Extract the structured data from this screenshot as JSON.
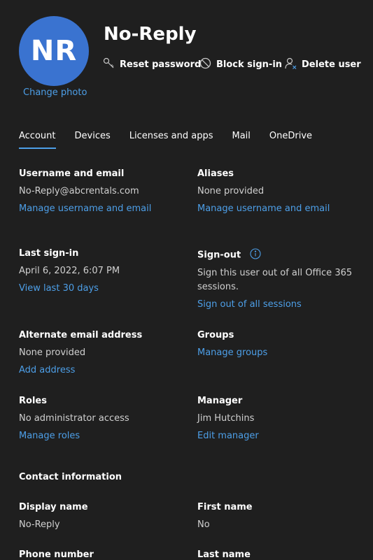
{
  "user": {
    "initials": "NR",
    "change_photo": "Change photo",
    "display_name": "No-Reply"
  },
  "actions": {
    "reset_password": "Reset password",
    "block_sign_in": "Block sign-in",
    "delete_user": "Delete user"
  },
  "tabs": [
    "Account",
    "Devices",
    "Licenses and apps",
    "Mail",
    "OneDrive"
  ],
  "account": {
    "username": {
      "label": "Username and email",
      "value": "No-Reply@abcrentals.com",
      "link": "Manage username and email"
    },
    "aliases": {
      "label": "Aliases",
      "value": "None provided",
      "link": "Manage username and email"
    },
    "last_signin": {
      "label": "Last sign-in",
      "value": "April 6, 2022, 6:07 PM",
      "link": "View last 30 days"
    },
    "signout": {
      "label": "Sign-out",
      "value_line1": "Sign this user out of all Office 365",
      "value_line2": "sessions.",
      "link": "Sign out of all sessions"
    },
    "alt_email": {
      "label": "Alternate email address",
      "value": "None provided",
      "link": "Add address"
    },
    "groups": {
      "label": "Groups",
      "link": "Manage groups"
    },
    "roles": {
      "label": "Roles",
      "value": "No administrator access",
      "link": "Manage roles"
    },
    "manager": {
      "label": "Manager",
      "value": "Jim Hutchins",
      "link": "Edit manager"
    }
  },
  "contact": {
    "heading": "Contact information",
    "display_name": {
      "label": "Display name",
      "value": "No-Reply"
    },
    "first_name": {
      "label": "First name",
      "value": "No"
    },
    "phone_number": {
      "label": "Phone number"
    },
    "last_name": {
      "label": "Last name"
    }
  },
  "colors": {
    "background": "#1f1f1f",
    "accent": "#4d9fe8",
    "avatar": "#3a73d0"
  }
}
